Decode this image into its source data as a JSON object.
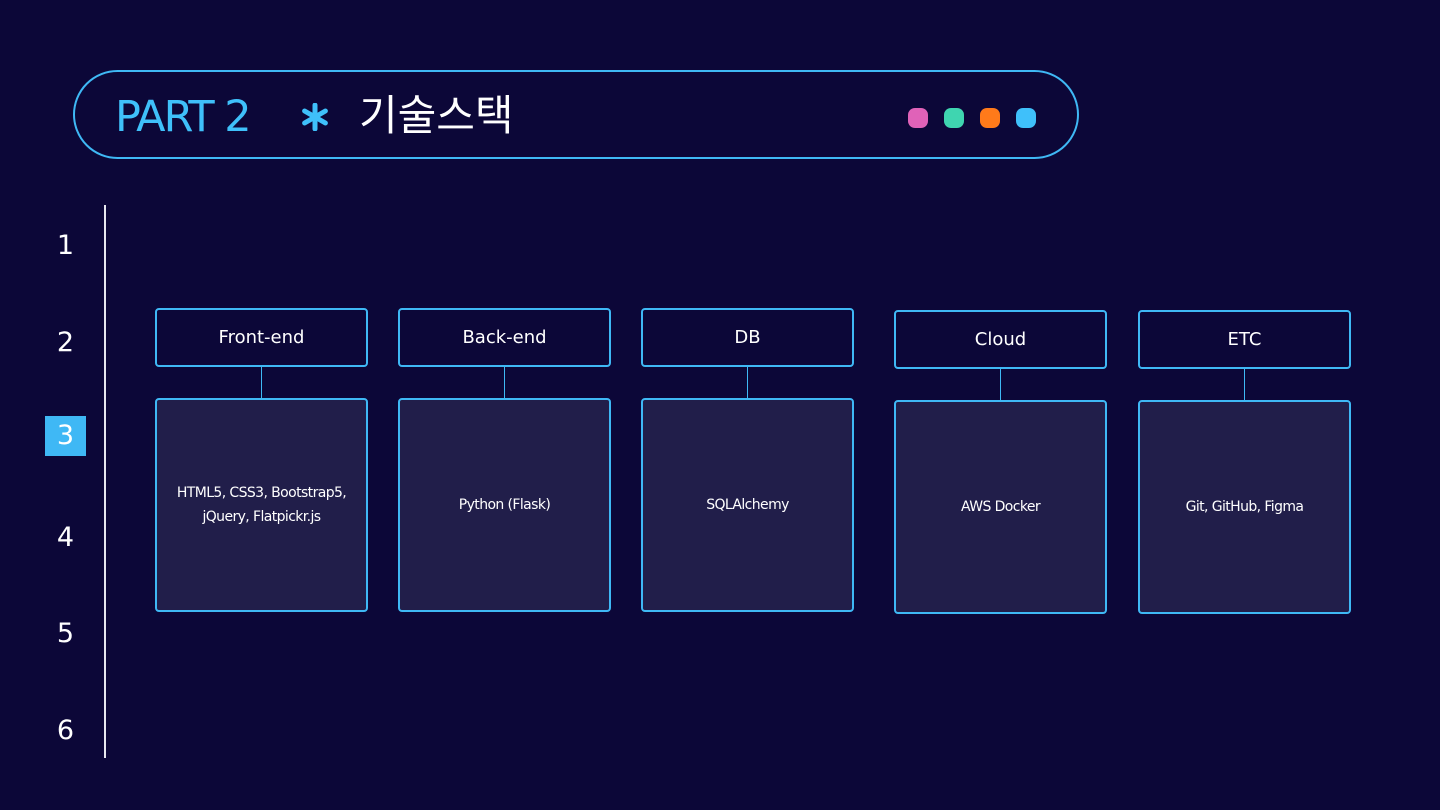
{
  "header": {
    "part_label": "PART 2",
    "title": "기술스택",
    "asterisk_icon": "asterisk-icon",
    "dots": [
      {
        "color": "#e062b8"
      },
      {
        "color": "#3fd5b0"
      },
      {
        "color": "#ff7a1a"
      },
      {
        "color": "#3fc0fa"
      }
    ]
  },
  "nav": {
    "items": [
      {
        "label": "1",
        "active": false
      },
      {
        "label": "2",
        "active": false
      },
      {
        "label": "3",
        "active": true
      },
      {
        "label": "4",
        "active": false
      },
      {
        "label": "5",
        "active": false
      },
      {
        "label": "6",
        "active": false
      }
    ]
  },
  "stack": [
    {
      "title": "Front-end",
      "content": "HTML5, CSS3, Bootstrap5, jQuery, Flatpickr.js"
    },
    {
      "title": "Back-end",
      "content": "Python (Flask)"
    },
    {
      "title": "DB",
      "content": "SQLAlchemy"
    },
    {
      "title": "Cloud",
      "content": "AWS Docker"
    },
    {
      "title": "ETC",
      "content": "Git, GitHub, Figma"
    }
  ],
  "colors": {
    "background": "#0c0738",
    "accent": "#3fb8f5",
    "card_fill": "#211e4a"
  }
}
